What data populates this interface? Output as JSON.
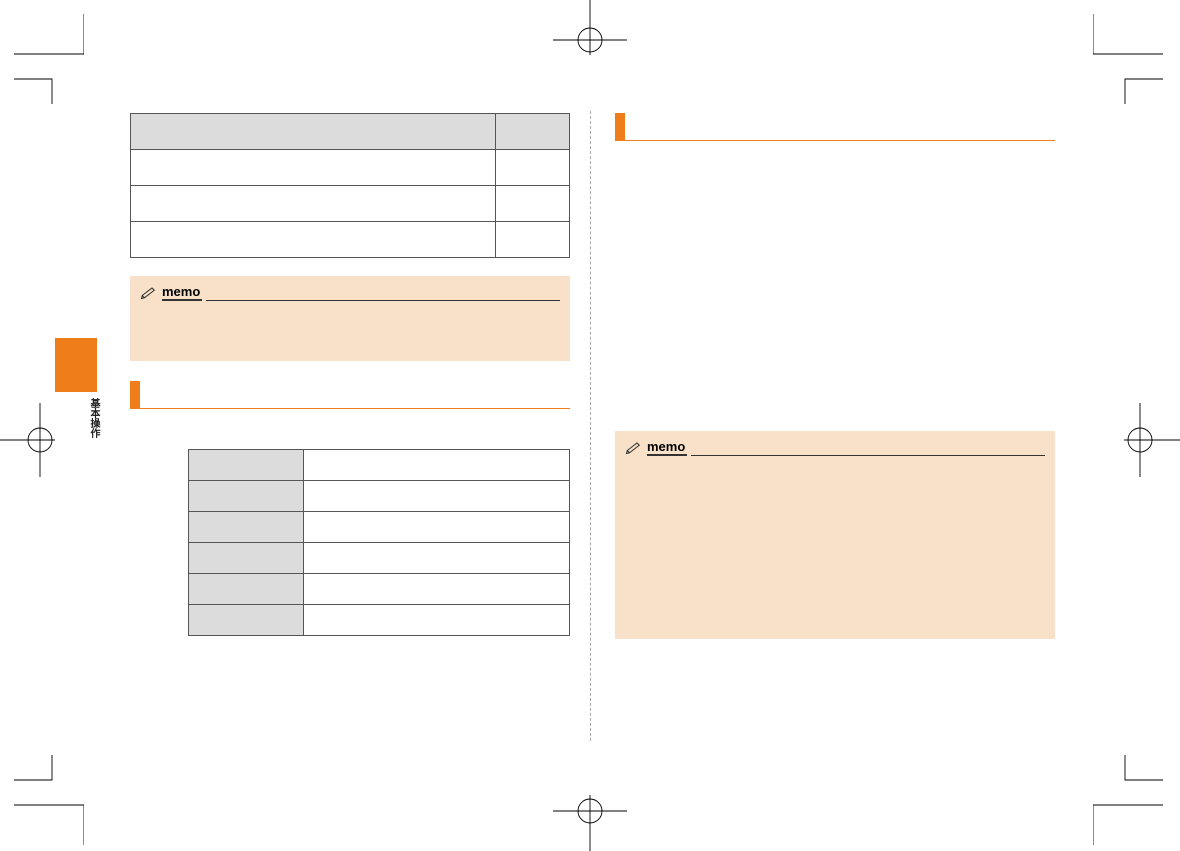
{
  "side_tab": {
    "label": "基本操作"
  },
  "memo": {
    "label": "memo"
  },
  "left_page": {
    "table1": {
      "header": [
        "",
        ""
      ],
      "rows": [
        [
          "",
          ""
        ],
        [
          "",
          ""
        ],
        [
          "",
          ""
        ]
      ]
    },
    "section_title": "",
    "table2": {
      "rows": [
        [
          "",
          ""
        ],
        [
          "",
          ""
        ],
        [
          "",
          ""
        ],
        [
          "",
          ""
        ],
        [
          "",
          ""
        ],
        [
          "",
          ""
        ]
      ]
    }
  },
  "right_page": {
    "section_title": ""
  }
}
